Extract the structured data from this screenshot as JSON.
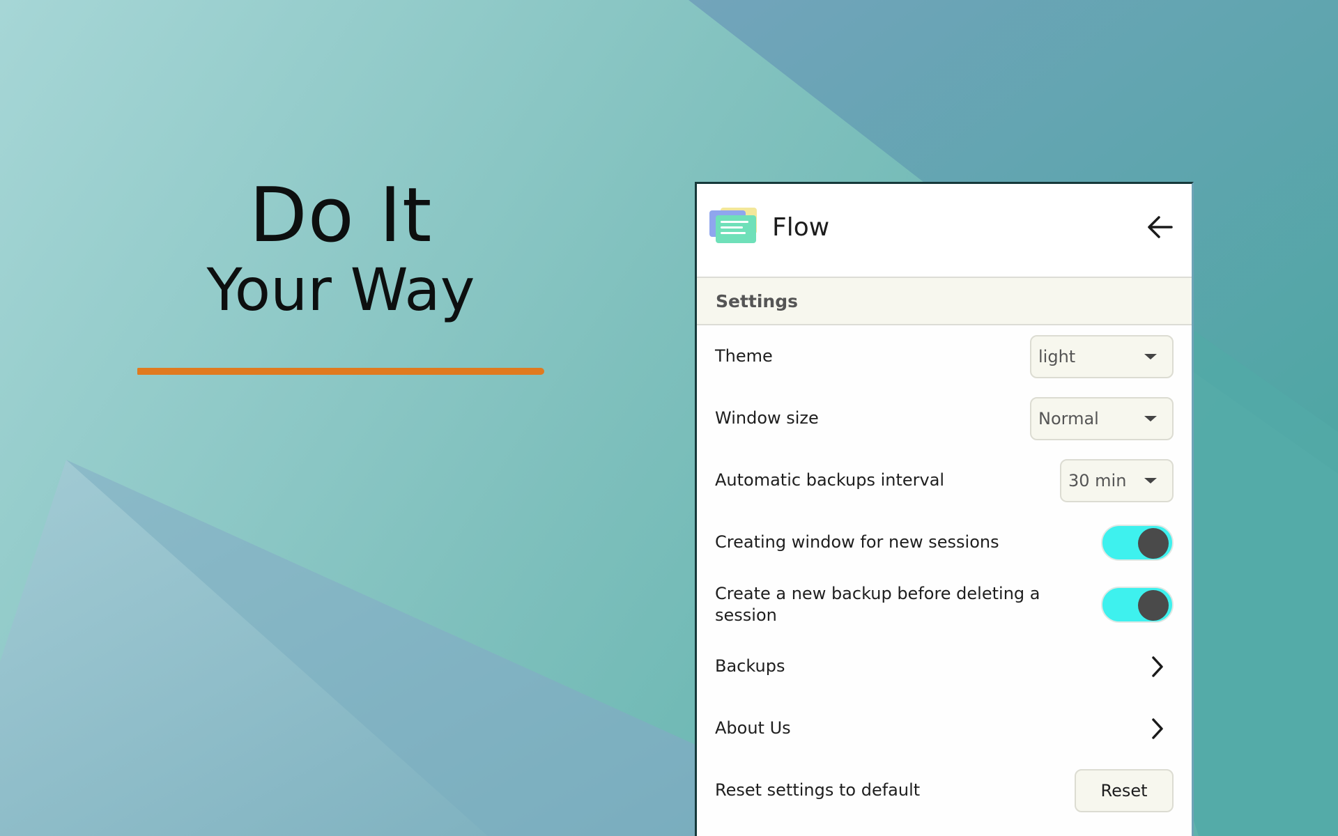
{
  "colors": {
    "accent_underline": "#e07a1f",
    "toggle_on": "#3ef1ee",
    "section_bg": "#f7f7ee"
  },
  "hero": {
    "line1": "Do It",
    "line2": "Your Way"
  },
  "app": {
    "title": "Flow",
    "logo_icon": "stacked-notes-icon",
    "back_icon": "arrow-left-icon"
  },
  "settings": {
    "section_title": "Settings",
    "theme": {
      "label": "Theme",
      "value": "light"
    },
    "window_size": {
      "label": "Window size",
      "value": "Normal"
    },
    "backup_interval": {
      "label": "Automatic backups interval",
      "value": "30 min"
    },
    "new_session_window": {
      "label": "Creating window for new sessions",
      "enabled": true
    },
    "backup_before_delete": {
      "label": "Create a new backup before deleting a session",
      "enabled": true
    },
    "backups": {
      "label": "Backups"
    },
    "about": {
      "label": "About Us"
    },
    "reset": {
      "label": "Reset settings to default",
      "button": "Reset"
    }
  }
}
